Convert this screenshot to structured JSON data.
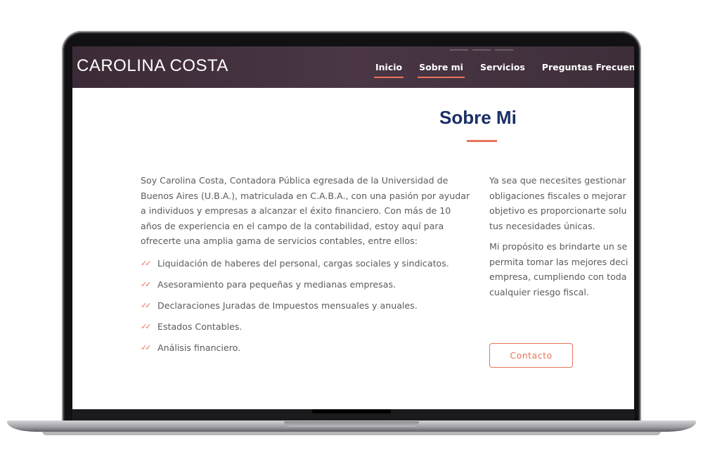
{
  "header": {
    "brand": "CAROLINA COSTA",
    "nav": [
      {
        "label": "Inicio",
        "active": true
      },
      {
        "label": "Sobre mi",
        "active": true
      },
      {
        "label": "Servicios",
        "active": false
      },
      {
        "label": "Preguntas Frecuentes",
        "active": false
      }
    ]
  },
  "about": {
    "title": "Sobre Mi",
    "intro": "Soy Carolina Costa, Contadora Pública egresada de la Universidad de Buenos Aires (U.B.A.), matriculada en C.A.B.A., con una pasión por ayudar a individuos y empresas a alcanzar el éxito financiero. Con más de 10 años de experiencia en el campo de la contabilidad, estoy aquí para ofrecerte una amplia gama de servicios contables, entre ellos:",
    "services": [
      "Liquidación de haberes del personal, cargas sociales y sindicatos.",
      "Asesoramiento para pequeñas y medianas empresas.",
      "Declaraciones Juradas de Impuestos mensuales y anuales.",
      "Estados Contables.",
      "Análisis financiero."
    ],
    "right_paragraph_1_lines": [
      "Ya sea que necesites gestionar",
      "obligaciones fiscales o mejorar",
      "objetivo es proporcionarte solu",
      "tus necesidades únicas."
    ],
    "right_paragraph_2_lines": [
      "Mi propósito es brindarte un se",
      "permita tomar las mejores deci",
      "empresa, cumpliendo con toda",
      "cualquier riesgo fiscal."
    ],
    "contact_button": "Contacto"
  },
  "colors": {
    "accent": "#e8755a",
    "title": "#1a2f66",
    "nav_bg": "#3c2b37",
    "text": "#5b5b5b"
  },
  "icons": {
    "check": "double-check-icon"
  }
}
